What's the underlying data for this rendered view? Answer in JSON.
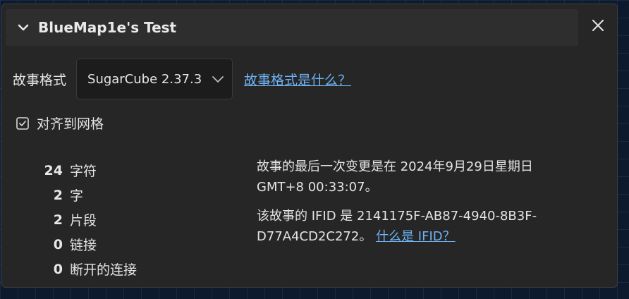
{
  "dialog": {
    "title": "BlueMap1e's Test",
    "close_label": "×"
  },
  "format": {
    "label": "故事格式",
    "selected": "SugarCube 2.37.3",
    "help_link": "故事格式是什么？"
  },
  "snap": {
    "label": "对齐到网格",
    "checked": true
  },
  "stats": [
    {
      "value": "24",
      "label": "字符"
    },
    {
      "value": "2",
      "label": "字"
    },
    {
      "value": "2",
      "label": "片段"
    },
    {
      "value": "0",
      "label": "链接"
    },
    {
      "value": "0",
      "label": "断开的连接"
    }
  ],
  "info": {
    "last_changed_line1": "故事的最后一次变更是在 2024年9月29日星期日",
    "last_changed_line2": "GMT+8 00:33:07。",
    "ifid_line1": "该故事的 IFID 是 2141175F-AB87-4940-8B3F-",
    "ifid_line2": "D77A4CD2C272。",
    "ifid_link": "什么是 IFID？"
  },
  "colors": {
    "background": "#0d1a2e",
    "dialog": "#262626",
    "titlebar": "#2e2e2e",
    "link": "#6fb3f5"
  }
}
